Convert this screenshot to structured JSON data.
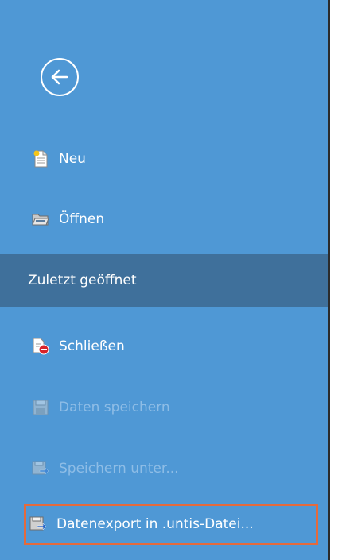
{
  "menu": {
    "back_icon": "arrow-left-circle-icon",
    "items": [
      {
        "label": "Neu",
        "icon": "new-document-icon",
        "enabled": true
      },
      {
        "label": "Öffnen",
        "icon": "open-folder-icon",
        "enabled": true
      },
      {
        "label": "Zuletzt geöffnet",
        "icon": "",
        "enabled": true,
        "selected": true
      },
      {
        "label": "Schließen",
        "icon": "close-document-icon",
        "enabled": true
      },
      {
        "label": "Daten speichern",
        "icon": "save-icon",
        "enabled": false
      },
      {
        "label": "Speichern unter...",
        "icon": "save-as-icon",
        "enabled": false
      },
      {
        "label": "Datenexport in .untis-Datei...",
        "icon": "export-icon",
        "enabled": true,
        "highlighted": true
      }
    ]
  },
  "colors": {
    "panel_background": "#4f98d5",
    "selected_background": "#3f709b",
    "highlight_border": "#e46a3c",
    "disabled_text": "#8ebde6"
  }
}
